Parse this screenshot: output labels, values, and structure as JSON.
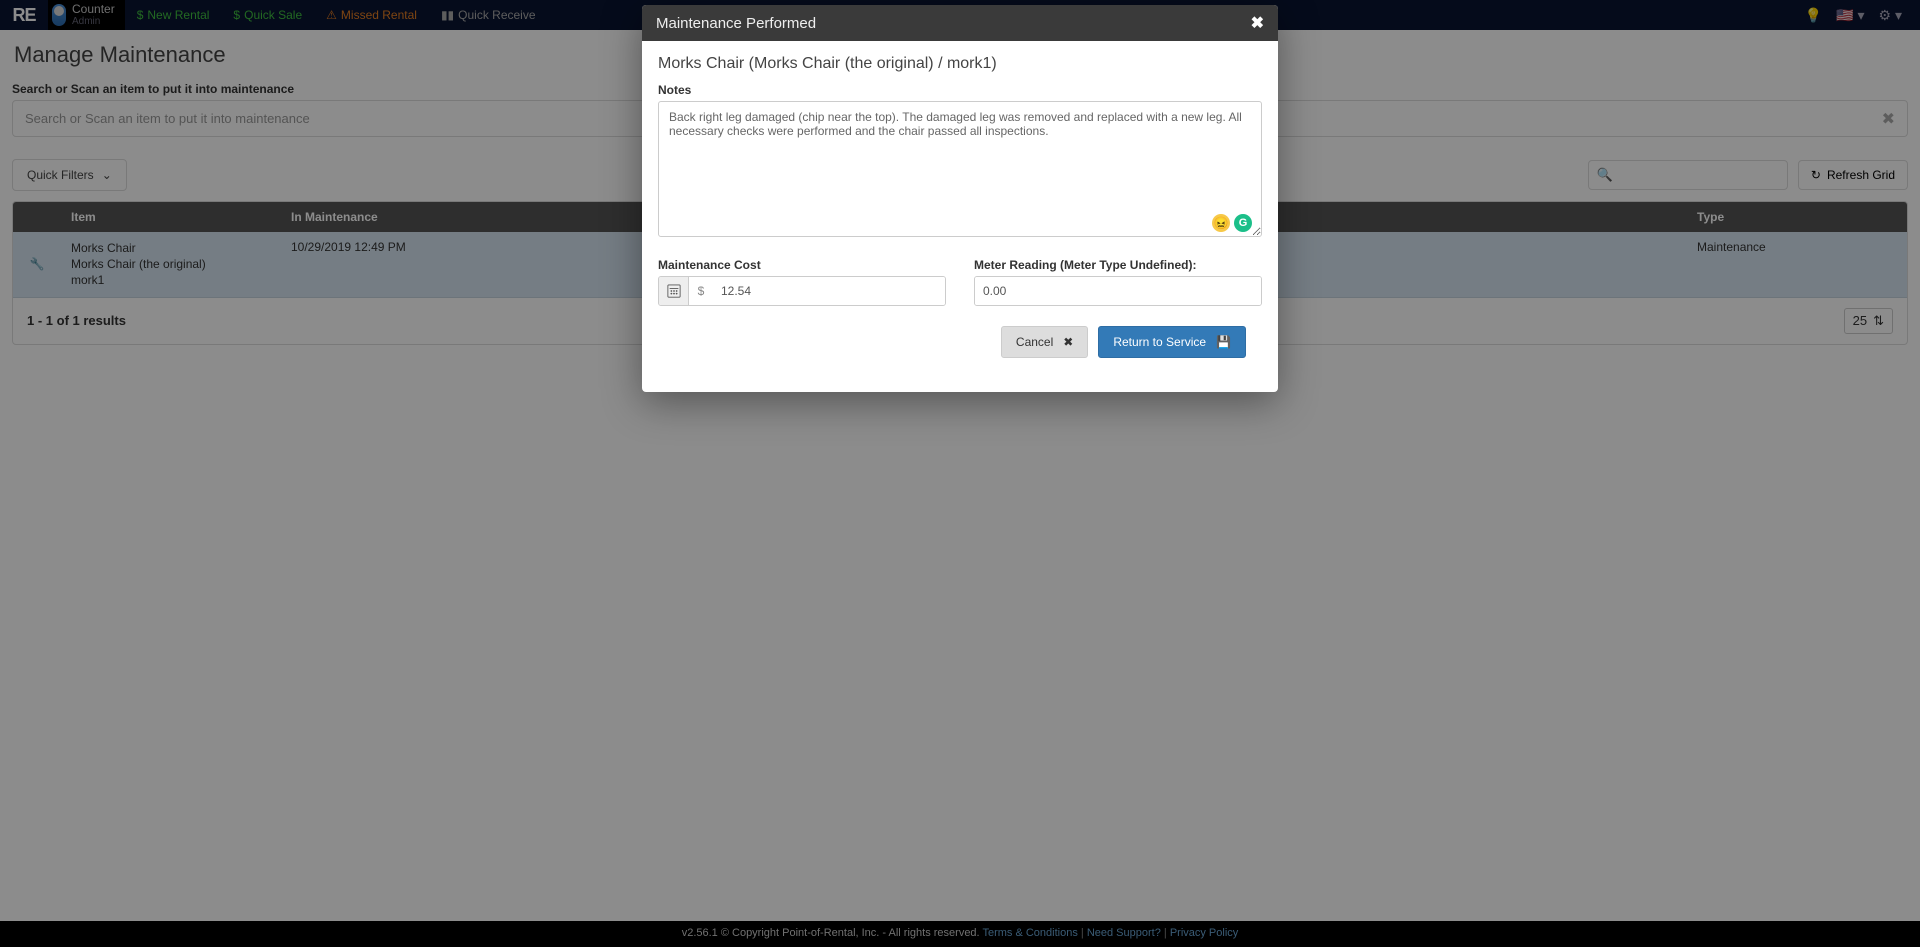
{
  "navbar": {
    "logo": "RE",
    "counter": {
      "label": "Counter",
      "sub": "Admin"
    },
    "items": {
      "new_rental": "New Rental",
      "quick_sale": "Quick Sale",
      "missed_rental": "Missed Rental",
      "quick_receive": "Quick Receive"
    }
  },
  "page": {
    "title": "Manage Maintenance",
    "search_label": "Search or Scan an item to put it into maintenance",
    "search_placeholder": "Search or Scan an item to put it into maintenance",
    "quick_filters": "Quick Filters",
    "refresh": "Refresh Grid"
  },
  "table": {
    "headers": {
      "item": "Item",
      "in_maintenance": "In Maintenance",
      "type": "Type"
    },
    "row": {
      "item_name": "Morks Chair",
      "item_desc": "Morks Chair (the original)",
      "item_code": "mork1",
      "in_maint": "10/29/2019 12:49 PM",
      "type": "Maintenance"
    },
    "results": "1 - 1 of 1 results",
    "page_size": "25"
  },
  "modal": {
    "title": "Maintenance Performed",
    "item_title": "Morks Chair (Morks Chair (the original) / mork1)",
    "notes_label": "Notes",
    "notes_value": "Back right leg damaged (chip near the top). The damaged leg was removed and replaced with a new leg. All necessary checks were performed and the chair passed all inspections.",
    "cost_label": "Maintenance Cost",
    "cost_currency": "$",
    "cost_value": "12.54",
    "meter_label": "Meter Reading (Meter Type Undefined):",
    "meter_value": "0.00",
    "cancel": "Cancel",
    "return": "Return to Service"
  },
  "footer": {
    "version": "v2.56.1 © Copyright Point-of-Rental, Inc. - All rights reserved.",
    "terms": "Terms & Conditions",
    "support": "Need Support?",
    "privacy": "Privacy Policy"
  }
}
